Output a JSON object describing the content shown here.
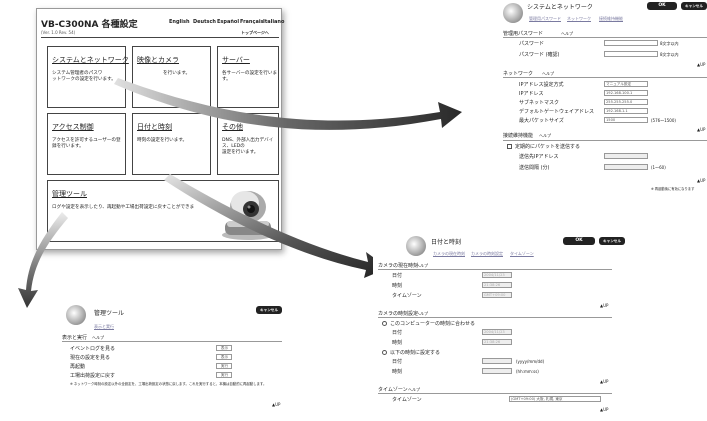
{
  "main": {
    "title": "VB-C300NA 各種設定",
    "version": "(Ver. 1.0 Rev. 54)",
    "languages": [
      "English",
      "Deutsch",
      "Español",
      "Français",
      "Italiano"
    ],
    "top_link": "トップページへ",
    "cells": [
      {
        "title": "システムとネットワーク",
        "desc": "システム管理者のパスワ\nットワークの設定を行います。"
      },
      {
        "title": "映像とカメラ",
        "desc": "を行います。"
      },
      {
        "title": "サーバー",
        "desc": "各サーバーの設定を行います。"
      },
      {
        "title": "アクセス制御",
        "desc": "アクセスを許可するユーザーの登\n録を行います。"
      },
      {
        "title": "日付と時刻",
        "desc": "時刻の設定を行います。"
      },
      {
        "title": "その他",
        "desc": "DNS、外部入出力デバイス、LEDの\n設定を行います。"
      },
      {
        "title": "管理ツール",
        "desc": "ログや設定を表示したり、再起動や工場出荷設定に戻すことができま"
      }
    ]
  },
  "net": {
    "title": "システムとネットワーク",
    "ok": "OK",
    "cancel": "キャンセル",
    "breadcrumb": [
      "管理用パスワード",
      "ネットワーク",
      "接続維持機能"
    ],
    "section1": "管理用パスワード",
    "help": "ヘルプ",
    "password_label": "パスワード",
    "password_hint": "8文字以内",
    "password_confirm_label": "パスワード (確認)",
    "section2": "ネットワーク",
    "ip_method_label": "IPアドレス設定方式",
    "ip_method_value": "マニュアル設定",
    "ip_label": "IPアドレス",
    "ip_value": "192.168.100.1",
    "mask_label": "サブネットマスク",
    "mask_value": "255.255.255.0",
    "gw_label": "デフォルトゲートウェイアドレス",
    "gw_value": "192.168.1.1",
    "mtu_label": "最大パケットサイズ",
    "mtu_value": "1500",
    "mtu_range": "(576〜1500)",
    "section3": "接続維持機能",
    "keepalive_label": "定期的にパケットを送信する",
    "dest_label": "送信先IPアドレス",
    "interval_label": "送信間隔 (分)",
    "interval_range": "(1〜60)",
    "up": "▲UP",
    "note": "※ 再起動後に有効になります"
  },
  "date": {
    "title": "日付と時刻",
    "ok": "OK",
    "cancel": "キャンセル",
    "breadcrumb": [
      "カメラの現在時刻",
      "カメラの時刻設定",
      "タイムゾーン"
    ],
    "section1": "カメラの現在時刻",
    "help": "ヘルプ",
    "date_label": "日付",
    "time_label": "時刻",
    "tz_label": "タイムゾーン",
    "cur_date": "2004/11/23",
    "cur_time": "21:38:26",
    "cur_tz": "GMT+09:00",
    "section2": "カメラの時刻設定",
    "sync_label": "このコンピューターの時刻に合わせる",
    "sync_date": "2004/11/23",
    "sync_time": "21:38:26",
    "manual_label": "以下の時刻に設定する",
    "date_fmt": "(yyyy/mm/dd)",
    "time_fmt": "(hh:mm:ss)",
    "section3": "タイムゾーン",
    "tz_value": "(GMT+09:00) 大阪, 札幌, 東京",
    "up": "▲UP"
  },
  "tools": {
    "title": "管理ツール",
    "cancel": "キャンセル",
    "breadcrumb": "表示と実行",
    "section": "表示と実行",
    "help": "ヘルプ",
    "rows": [
      "イベントログを見る",
      "現在の設定を見る",
      "再起動",
      "工場出荷設定に戻す"
    ],
    "row_buttons": [
      "表示",
      "表示",
      "実行",
      "実行"
    ],
    "note": "※ ネットワーク時刻の設定以外の全設定を、工場出荷設定の状態に戻します。これを実行すると、本機は自動的に再起動します。",
    "up": "▲UP"
  }
}
